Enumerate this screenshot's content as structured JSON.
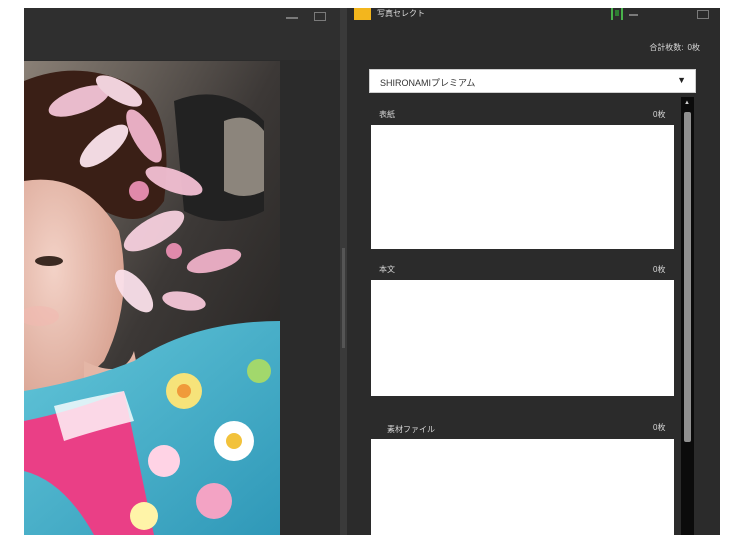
{
  "right_panel": {
    "app_title": "写真セレクト",
    "total_label": "合計枚数:",
    "total_value": "0枚",
    "select_value": "SHIRONAMIプレミアム",
    "sections": [
      {
        "label": "表紙",
        "count": "0枚"
      },
      {
        "label": "本文",
        "count": "0枚"
      },
      {
        "label": "素材ファイル",
        "count": "0枚"
      }
    ]
  },
  "icons": {
    "dropdown": "triangle-down",
    "scroll_up": "triangle-up"
  },
  "colors": {
    "app_bg": "#2b2b2b",
    "accent_yellow": "#f3b61d",
    "accent_green": "#49b24b"
  }
}
